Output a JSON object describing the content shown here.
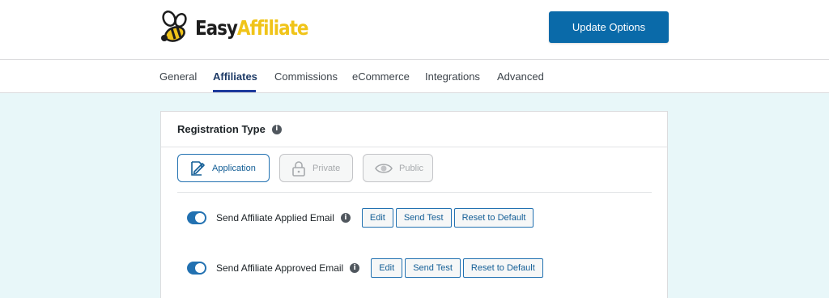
{
  "header": {
    "logo": {
      "word1": "Easy",
      "word2": "Affiliate",
      "accent_color": "#f0c419",
      "icon": "bee-icon"
    },
    "update_button": "Update Options"
  },
  "tabs": [
    {
      "label": "General",
      "active": false
    },
    {
      "label": "Affiliates",
      "active": true
    },
    {
      "label": "Commissions",
      "active": false
    },
    {
      "label": "eCommerce",
      "active": false
    },
    {
      "label": "Integrations",
      "active": false
    },
    {
      "label": "Advanced",
      "active": false
    }
  ],
  "registration": {
    "title": "Registration Type",
    "types": [
      {
        "label": "Application",
        "icon": "application-edit-icon",
        "selected": true
      },
      {
        "label": "Private",
        "icon": "lock-icon",
        "selected": false
      },
      {
        "label": "Public",
        "icon": "eye-icon",
        "selected": false
      }
    ],
    "emails": [
      {
        "label": "Send Affiliate Applied Email",
        "enabled": true,
        "actions": [
          "Edit",
          "Send Test",
          "Reset to Default"
        ]
      },
      {
        "label": "Send Affiliate Approved Email",
        "enabled": true,
        "actions": [
          "Edit",
          "Send Test",
          "Reset to Default"
        ]
      }
    ]
  },
  "colors": {
    "primary": "#0a6aa9",
    "accent": "#2271b1",
    "page_background": "#e8f7f9"
  }
}
